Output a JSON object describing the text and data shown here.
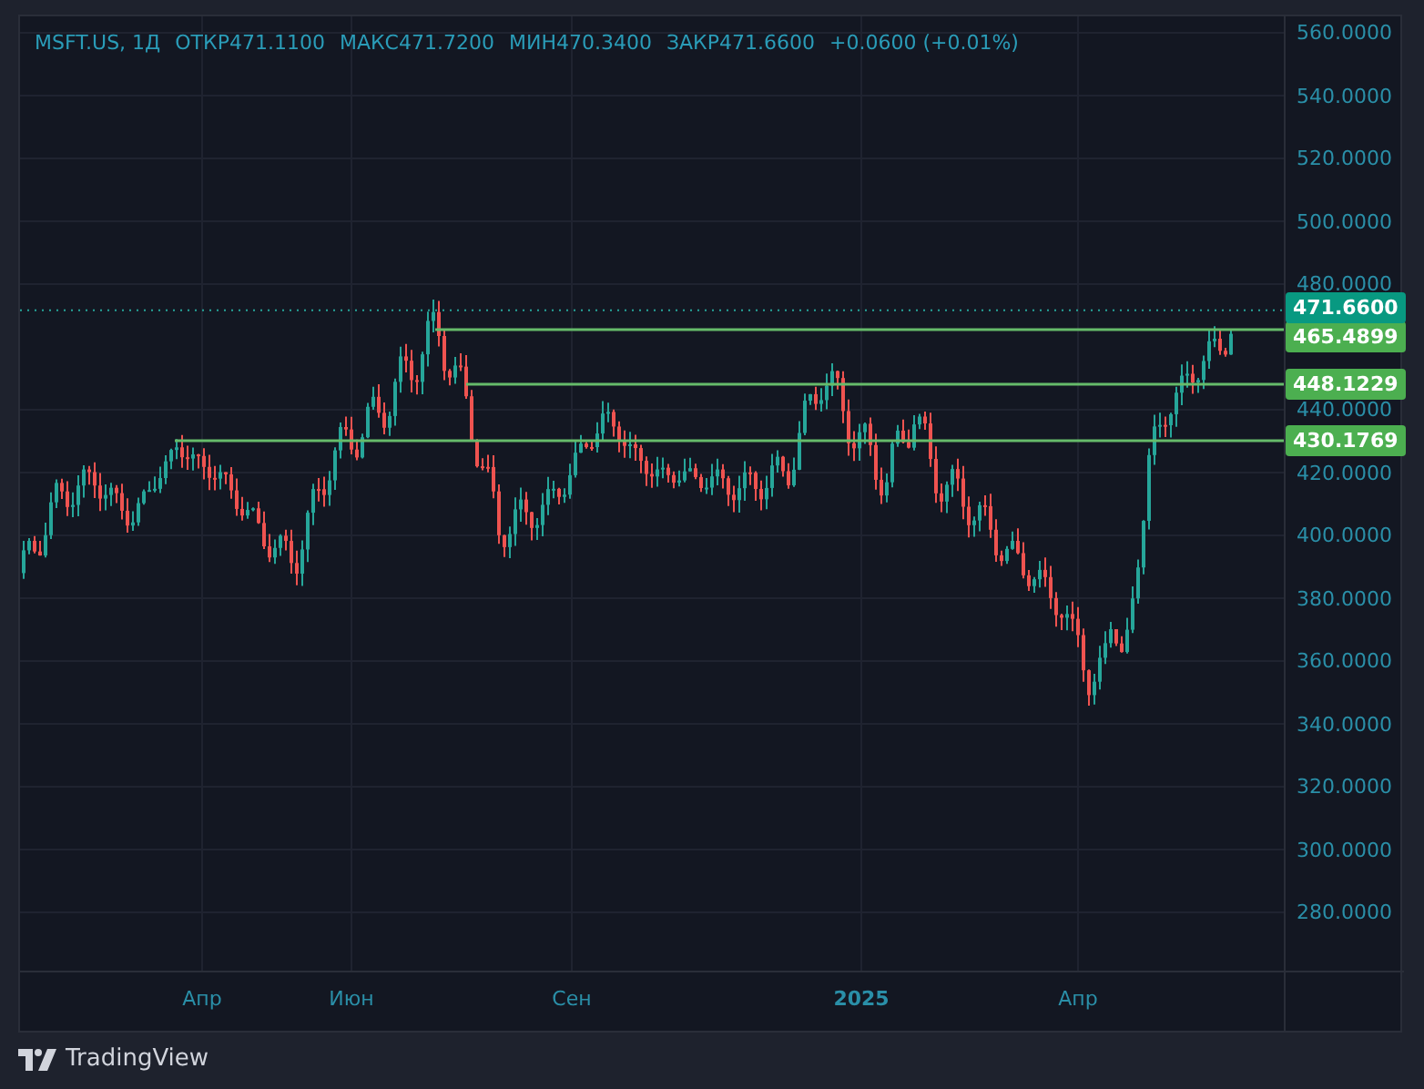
{
  "legend": {
    "symbol": "MSFT.US, 1Д",
    "fields": [
      {
        "label": "ОТКР",
        "value": "471.1100"
      },
      {
        "label": "МАКС",
        "value": "471.7200"
      },
      {
        "label": "МИН",
        "value": "470.3400"
      },
      {
        "label": "ЗАКР",
        "value": "471.6600"
      }
    ],
    "change": "+0.0600 (+0.01%)"
  },
  "price_axis": [
    "560.0000",
    "540.0000",
    "520.0000",
    "500.0000",
    "480.0000",
    "440.0000",
    "420.0000",
    "400.0000",
    "380.0000",
    "360.0000",
    "340.0000",
    "320.0000",
    "300.0000",
    "280.0000"
  ],
  "time_axis": [
    "Апр",
    "Июн",
    "Сен",
    "2025",
    "Апр"
  ],
  "current_price": "471.6600",
  "levels": [
    "465.4899",
    "448.1229",
    "430.1769"
  ],
  "branding": "TradingView"
}
